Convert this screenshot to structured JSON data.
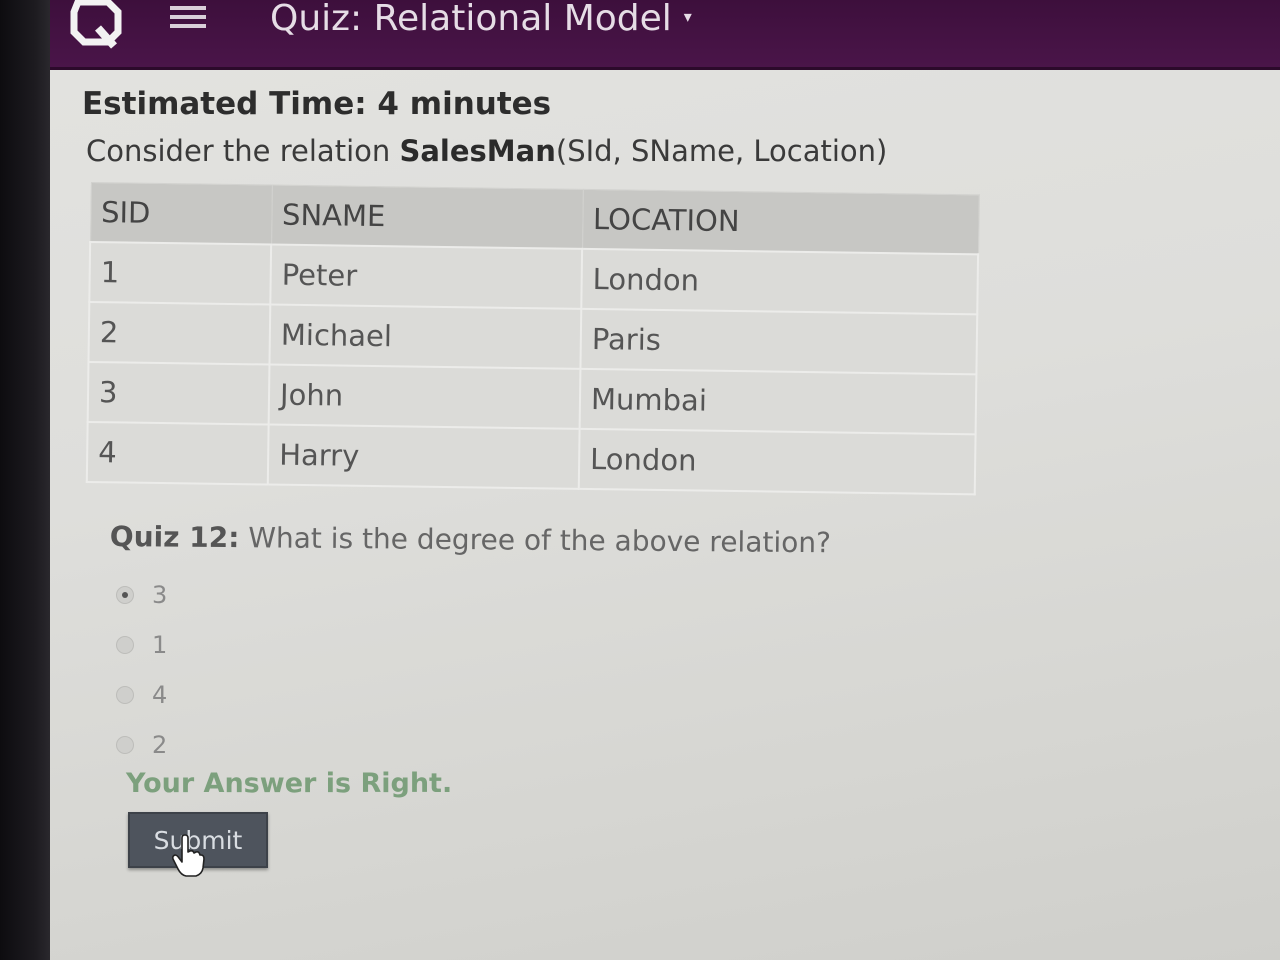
{
  "header": {
    "title": "Quiz: Relational Model",
    "logo_icon": "quiz-app-logo-icon",
    "menu_icon": "hamburger-menu-icon",
    "title_caret": "▾"
  },
  "content": {
    "estimated_time": "Estimated Time: 4 minutes",
    "relation_prefix": "Consider the relation ",
    "relation_name": "SalesMan",
    "relation_attrs": "(SId, SName, Location)",
    "table": {
      "headers": [
        "SID",
        "SNAME",
        "LOCATION"
      ],
      "rows": [
        [
          "1",
          "Peter",
          "London"
        ],
        [
          "2",
          "Michael",
          "Paris"
        ],
        [
          "3",
          "John",
          "Mumbai"
        ],
        [
          "4",
          "Harry",
          "London"
        ]
      ]
    },
    "question_label": "Quiz 12:",
    "question_text": " What is the degree of the above relation?",
    "options": [
      {
        "label": "3",
        "selected": true
      },
      {
        "label": "1",
        "selected": false
      },
      {
        "label": "4",
        "selected": false
      },
      {
        "label": "2",
        "selected": false
      }
    ],
    "feedback": "Your Answer is Right.",
    "submit_label": "Submit"
  },
  "colors": {
    "header_bg": "#4a1549",
    "page_bg": "#dededb",
    "feedback": "#7ca07d",
    "submit_bg": "#4e545d"
  }
}
